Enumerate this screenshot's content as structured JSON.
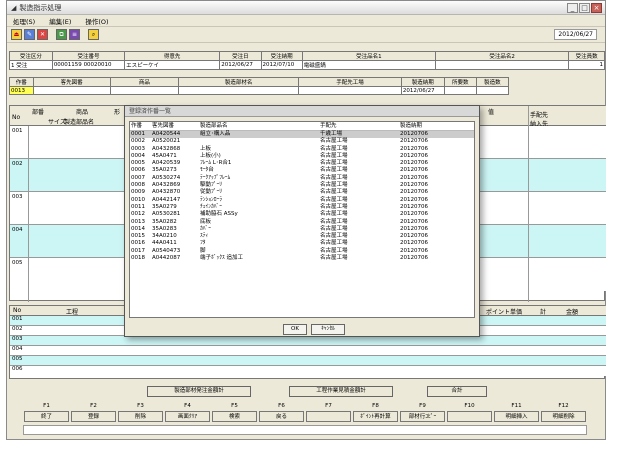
{
  "window": {
    "title": "製造指示処理"
  },
  "menu": [
    "処理(S)",
    "編集(E)",
    "操作(O)"
  ],
  "toolbar": {
    "date": "2012/06/27"
  },
  "header": {
    "labels": [
      "受注区分",
      "受注番号",
      "得意先",
      "受注日",
      "受注納期",
      "受注品名1",
      "受注品名2",
      "受注員数"
    ],
    "values": [
      "1 受注",
      "00001159",
      "00020010",
      "エスピーケイ",
      "2012/06/27",
      "2012/07/10",
      "電磁盛鍋",
      "",
      "1"
    ],
    "labels2": [
      "作番",
      "客先図番",
      "商品",
      "製造部材名",
      "手配先工場",
      "製造納期",
      "所要数",
      "製造数"
    ],
    "values2": [
      "0013",
      "2012/06/27"
    ]
  },
  "grid": {
    "headers": [
      "部番",
      "商品",
      "製造部品名",
      "No",
      "サイズ",
      "形",
      "手配先",
      "納入先",
      "值"
    ],
    "row_nos": [
      "001",
      "002",
      "003",
      "004",
      "005"
    ]
  },
  "lower": {
    "headers": [
      "No",
      "工程",
      "ポイント単価",
      "計",
      "金額"
    ],
    "row_nos": [
      "001",
      "002",
      "003",
      "004",
      "005",
      "006"
    ]
  },
  "totals": [
    "製造部材発注金額計",
    "工程作業見積金額計",
    "合計"
  ],
  "fkeys": [
    {
      "key": "F1",
      "label": "終了"
    },
    {
      "key": "F2",
      "label": "登録"
    },
    {
      "key": "F3",
      "label": "削除"
    },
    {
      "key": "F4",
      "label": "画面ｸﾘｱ"
    },
    {
      "key": "F5",
      "label": "検索"
    },
    {
      "key": "F6",
      "label": "戻る"
    },
    {
      "key": "F7",
      "label": ""
    },
    {
      "key": "F8",
      "label": "ﾎﾟｲﾝﾄ再計算"
    },
    {
      "key": "F9",
      "label": "部材行ｺﾋﾟｰ"
    },
    {
      "key": "F10",
      "label": ""
    },
    {
      "key": "F11",
      "label": "明細挿入"
    },
    {
      "key": "F12",
      "label": "明細削除"
    }
  ],
  "modal": {
    "title": "登録済作番一覧",
    "columns": [
      "作番",
      "客先図番",
      "製造部品名",
      "手配先",
      "製造納期"
    ],
    "rows": [
      [
        "0001",
        "A0420544",
        "組立･構入品",
        "千歳工場",
        "20120706"
      ],
      [
        "0002",
        "A0520021",
        "",
        "名古屋工場",
        "20120706"
      ],
      [
        "0003",
        "A0432868",
        "上板",
        "名古屋工場",
        "20120706"
      ],
      [
        "0004",
        "45A0471",
        "上板(小)",
        "名古屋工場",
        "20120706"
      ],
      [
        "0005",
        "A0420539",
        "ﾌﾚｰﾑ L･R合1",
        "名古屋工場",
        "20120706"
      ],
      [
        "0006",
        "35A0273",
        "ﾓｰﾀ台",
        "名古屋工場",
        "20120706"
      ],
      [
        "0007",
        "A0530274",
        "ﾃｰｸｱｯﾌﾟﾌﾚｰﾑ",
        "名古屋工場",
        "20120706"
      ],
      [
        "0008",
        "A0432869",
        "駆動ﾌﾟｰﾘ",
        "名古屋工場",
        "20120706"
      ],
      [
        "0009",
        "A0432870",
        "従動ﾌﾟｰﾘ",
        "名古屋工場",
        "20120706"
      ],
      [
        "0010",
        "A0442147",
        "ﾃﾝｼｮﾝﾛｰﾗ",
        "名古屋工場",
        "20120706"
      ],
      [
        "0011",
        "35A0279",
        "ﾁｪｲﾝｶﾊﾞｰ",
        "名古屋工場",
        "20120706"
      ],
      [
        "0012",
        "A0530281",
        "補助脇石 ASSy",
        "名古屋工場",
        "20120706"
      ],
      [
        "0013",
        "35A0282",
        "底板",
        "名古屋工場",
        "20120706"
      ],
      [
        "0014",
        "35A0283",
        "ｶﾊﾞｰ",
        "名古屋工場",
        "20120706"
      ],
      [
        "0015",
        "34A0210",
        "ｽﾃｨ",
        "名古屋工場",
        "20120706"
      ],
      [
        "0016",
        "44A0411",
        "ﾌﾀ",
        "名古屋工場",
        "20120706"
      ],
      [
        "0017",
        "A0540473",
        "脚",
        "名古屋工場",
        "20120706"
      ],
      [
        "0018",
        "A0442087",
        "端子ﾎﾞｯｸｽ 追加工",
        "名古屋工場",
        "20120706"
      ]
    ],
    "ok_label": "OK",
    "cancel_label": "ｷｬﾝｾﾙ"
  }
}
